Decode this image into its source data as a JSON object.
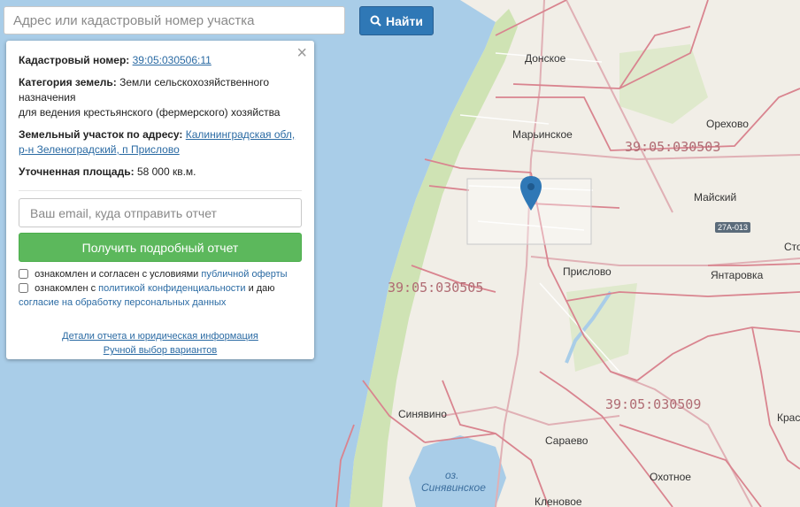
{
  "search": {
    "placeholder": "Адрес или кадастровый номер участка",
    "button_label": "Найти"
  },
  "panel": {
    "cadastral_label": "Кадастровый номер:",
    "cadastral_value": "39:05:030506:11",
    "category_label": "Категория земель:",
    "category_value_1": "Земли сельскохозяйственного назначения",
    "category_value_2": "для ведения крестьянского (фермерского) хозяйства",
    "address_label": "Земельный участок по адресу:",
    "address_value": "Калининградская обл, р-н Зеленоградский, п Прислово",
    "area_label": "Уточненная площадь:",
    "area_value": "58 000 кв.м.",
    "email_placeholder": "Ваш email, куда отправить отчет",
    "report_button": "Получить подробный отчет",
    "consent1_text": "ознакомлен и согласен с условиями",
    "consent1_link": "публичной оферты",
    "consent2_text_a": "ознакомлен с",
    "consent2_link_a": "политикой конфиденциальности",
    "consent2_text_b": "и даю",
    "consent2_link_b": "согласие на обработку персональных данных",
    "details_link": "Детали отчета и юридическая информация",
    "manual_link": "Ручной выбор вариантов"
  },
  "map": {
    "places": {
      "donskoe": "Донское",
      "maryinskoe": "Марьинское",
      "orekhovo": "Орехово",
      "maysky": "Майский",
      "prislovo": "Прислово",
      "yantarovka": "Янтаровка",
      "sto": "Сто",
      "sinyavino": "Синявино",
      "saraevo": "Сараево",
      "okhotnoe": "Охотное",
      "klenovoe": "Кленовое",
      "kras": "Крас",
      "lake_prefix": "оз.",
      "lake_name": "Синявинское"
    },
    "cadastral": {
      "q503": "39:05:030503",
      "q505": "39:05:030505",
      "q509": "39:05:030509"
    },
    "road_badge": "27А-013",
    "colors": {
      "sea": "#a9cde8",
      "land": "#f1eee7",
      "forest": "#cfe3b4",
      "cadastral_line": "#d9848f",
      "marker": "#2f78b6"
    }
  }
}
